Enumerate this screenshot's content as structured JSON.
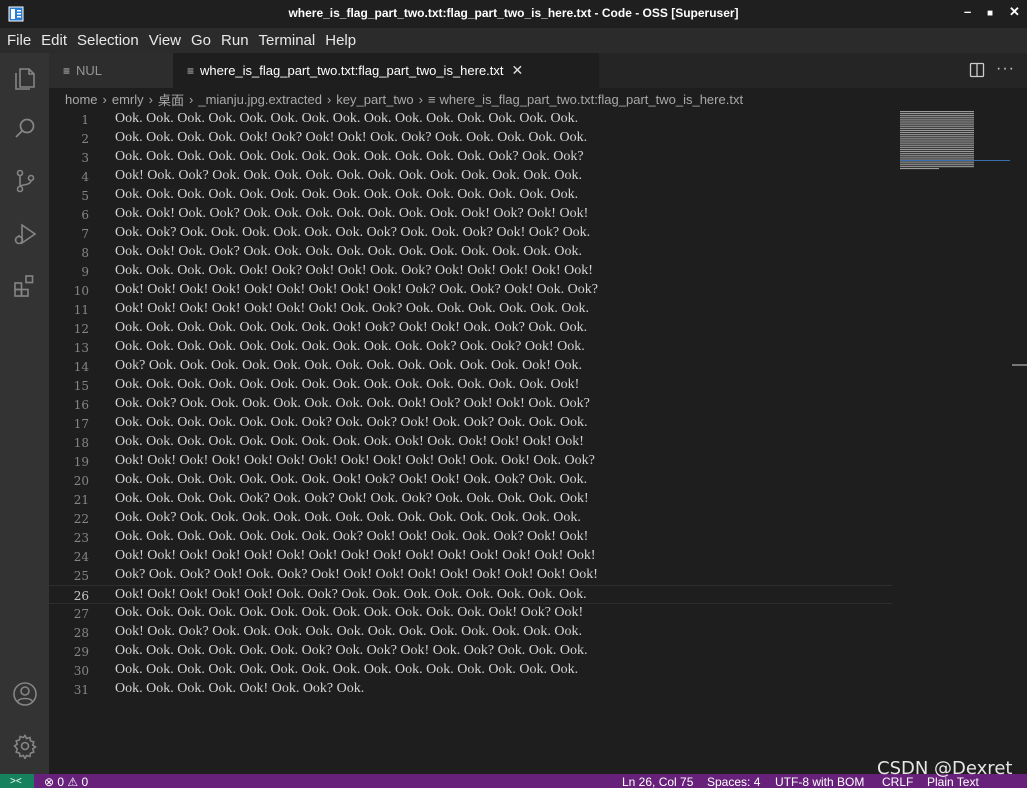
{
  "window": {
    "title": "where_is_flag_part_two.txt:flag_part_two_is_here.txt - Code - OSS [Superuser]",
    "minimize": "–",
    "maximize": "■",
    "close": "✕"
  },
  "menu": [
    "File",
    "Edit",
    "Selection",
    "View",
    "Go",
    "Run",
    "Terminal",
    "Help"
  ],
  "tabs": [
    {
      "label": "NUL",
      "icon": "≡",
      "active": false
    },
    {
      "label": "where_is_flag_part_two.txt:flag_part_two_is_here.txt",
      "icon": "≡",
      "active": true,
      "close": "✕"
    }
  ],
  "tab_actions": {
    "more": "···"
  },
  "breadcrumb": [
    "home",
    "emrly",
    "桌面",
    "_mianju.jpg.extracted",
    "key_part_two",
    "where_is_flag_part_two.txt:flag_part_two_is_here.txt"
  ],
  "breadcrumb_sep": "›",
  "breadcrumb_file_icon": "≡",
  "editor": {
    "current_line": 26,
    "lines": [
      "Ook. Ook. Ook. Ook. Ook. Ook. Ook. Ook. Ook. Ook. Ook. Ook. Ook. Ook. Ook.",
      "Ook. Ook. Ook. Ook. Ook! Ook? Ook! Ook! Ook. Ook? Ook. Ook. Ook. Ook. Ook.",
      "Ook. Ook. Ook. Ook. Ook. Ook. Ook. Ook. Ook. Ook. Ook. Ook. Ook? Ook. Ook?",
      "Ook! Ook. Ook? Ook. Ook. Ook. Ook. Ook. Ook. Ook. Ook. Ook. Ook. Ook. Ook.",
      "Ook. Ook. Ook. Ook. Ook. Ook. Ook. Ook. Ook. Ook. Ook. Ook. Ook. Ook. Ook.",
      "Ook. Ook! Ook. Ook? Ook. Ook. Ook. Ook. Ook. Ook. Ook. Ook! Ook? Ook! Ook!",
      "Ook. Ook? Ook. Ook. Ook. Ook. Ook. Ook. Ook? Ook. Ook. Ook? Ook! Ook? Ook.",
      "Ook. Ook! Ook. Ook? Ook. Ook. Ook. Ook. Ook. Ook. Ook. Ook. Ook. Ook. Ook.",
      "Ook. Ook. Ook. Ook. Ook! Ook? Ook! Ook! Ook. Ook? Ook! Ook! Ook! Ook! Ook!",
      "Ook! Ook! Ook! Ook! Ook! Ook! Ook! Ook! Ook! Ook? Ook. Ook? Ook! Ook. Ook?",
      "Ook! Ook! Ook! Ook! Ook! Ook! Ook! Ook. Ook? Ook. Ook. Ook. Ook. Ook. Ook.",
      "Ook. Ook. Ook. Ook. Ook. Ook. Ook. Ook! Ook? Ook! Ook! Ook. Ook? Ook. Ook.",
      "Ook. Ook. Ook. Ook. Ook. Ook. Ook. Ook. Ook. Ook. Ook? Ook. Ook? Ook! Ook.",
      "Ook? Ook. Ook. Ook. Ook. Ook. Ook. Ook. Ook. Ook. Ook. Ook. Ook. Ook! Ook.",
      "Ook. Ook. Ook. Ook. Ook. Ook. Ook. Ook. Ook. Ook. Ook. Ook. Ook. Ook. Ook!",
      "Ook. Ook? Ook. Ook. Ook. Ook. Ook. Ook. Ook. Ook! Ook? Ook! Ook! Ook. Ook?",
      "Ook. Ook. Ook. Ook. Ook. Ook. Ook? Ook. Ook? Ook! Ook. Ook? Ook. Ook. Ook.",
      "Ook. Ook. Ook. Ook. Ook. Ook. Ook. Ook. Ook. Ook! Ook. Ook! Ook! Ook! Ook!",
      "Ook! Ook! Ook! Ook! Ook! Ook! Ook! Ook! Ook! Ook! Ook! Ook. Ook! Ook. Ook?",
      "Ook. Ook. Ook. Ook. Ook. Ook. Ook. Ook! Ook? Ook! Ook! Ook. Ook? Ook. Ook.",
      "Ook. Ook. Ook. Ook. Ook? Ook. Ook? Ook! Ook. Ook? Ook. Ook. Ook. Ook. Ook!",
      "Ook. Ook? Ook. Ook. Ook. Ook. Ook. Ook. Ook. Ook. Ook. Ook. Ook. Ook. Ook.",
      "Ook. Ook. Ook. Ook. Ook. Ook. Ook. Ook? Ook! Ook! Ook. Ook. Ook? Ook! Ook!",
      "Ook! Ook! Ook! Ook! Ook! Ook! Ook! Ook! Ook! Ook! Ook! Ook! Ook! Ook! Ook!",
      "Ook? Ook. Ook? Ook! Ook. Ook? Ook! Ook! Ook! Ook! Ook! Ook! Ook! Ook! Ook!",
      "Ook! Ook! Ook! Ook! Ook! Ook. Ook? Ook. Ook. Ook. Ook. Ook. Ook. Ook. Ook.",
      "Ook. Ook. Ook. Ook. Ook. Ook. Ook. Ook. Ook. Ook. Ook. Ook. Ook! Ook? Ook!",
      "Ook! Ook. Ook? Ook. Ook. Ook. Ook. Ook. Ook. Ook. Ook. Ook. Ook. Ook. Ook.",
      "Ook. Ook. Ook. Ook. Ook. Ook. Ook? Ook. Ook? Ook! Ook. Ook? Ook. Ook. Ook.",
      "Ook. Ook. Ook. Ook. Ook. Ook. Ook. Ook. Ook. Ook. Ook. Ook. Ook. Ook. Ook.",
      "Ook. Ook. Ook. Ook. Ook! Ook. Ook? Ook."
    ]
  },
  "statusbar": {
    "remote_icon": "><",
    "problems": "⊗ 0 ⚠ 0",
    "position": "Ln 26, Col 75",
    "spaces": "Spaces: 4",
    "encoding": "UTF-8 with BOM",
    "eol": "CRLF",
    "language": "Plain Text",
    "bg_color": "#68217a",
    "remote_color": "#16825d"
  },
  "watermark": "CSDN @Dexret",
  "activity": [
    "explorer-icon",
    "search-icon",
    "source-control-icon",
    "run-debug-icon",
    "extensions-icon",
    "account-icon",
    "settings-gear-icon"
  ]
}
